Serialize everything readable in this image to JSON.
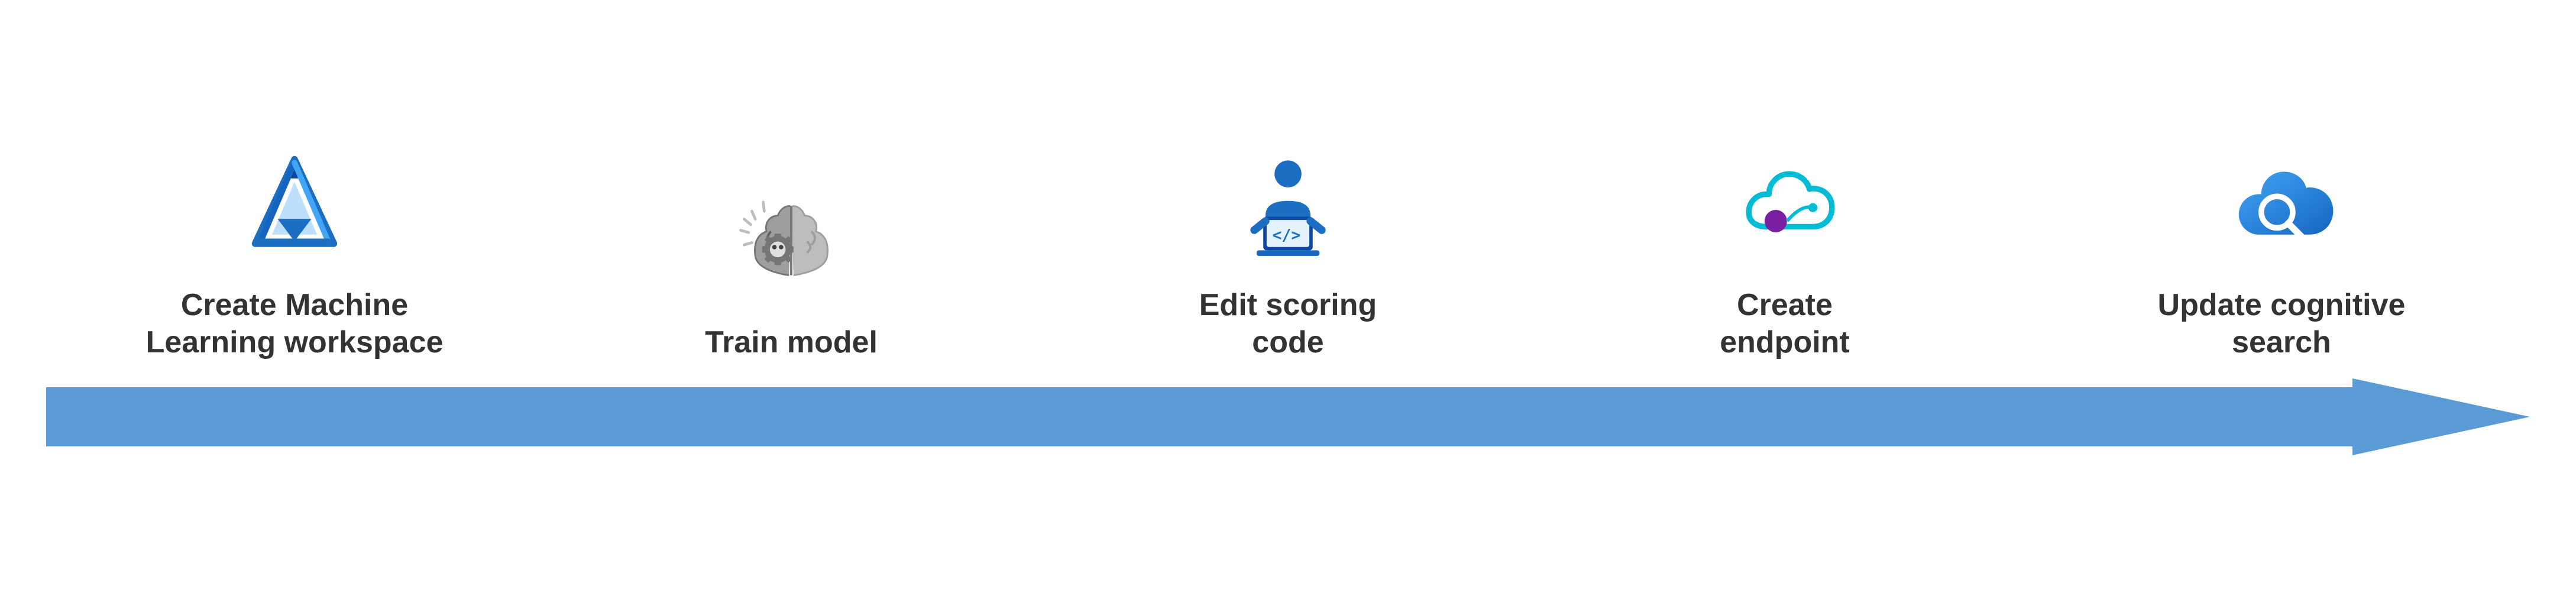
{
  "steps": [
    {
      "id": "create-ml-workspace",
      "label": "Create Machine\nLearning workspace",
      "icon": "azure-ml"
    },
    {
      "id": "train-model",
      "label": "Train model",
      "icon": "brain-gear"
    },
    {
      "id": "edit-scoring-code",
      "label": "Edit scoring\ncode",
      "icon": "coder"
    },
    {
      "id": "create-endpoint",
      "label": "Create\nendpoint",
      "icon": "cloud-endpoint"
    },
    {
      "id": "update-cognitive-search",
      "label": "Update cognitive\nsearch",
      "icon": "cloud-search"
    }
  ],
  "arrow": {
    "color": "#5B9BD5"
  }
}
